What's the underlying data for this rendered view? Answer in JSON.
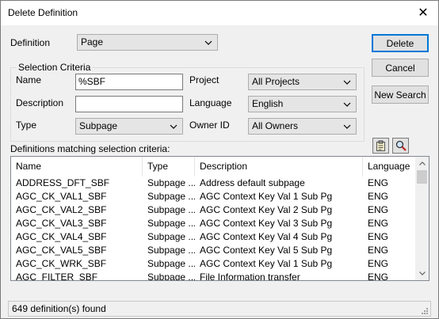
{
  "window": {
    "title": "Delete Definition",
    "close_glyph": "✕"
  },
  "definition": {
    "label": "Definition",
    "value": "Page"
  },
  "buttons": {
    "delete": "Delete",
    "cancel": "Cancel",
    "new_search": "New Search"
  },
  "criteria": {
    "title": "Selection Criteria",
    "name_label": "Name",
    "name_value": "%SBF",
    "description_label": "Description",
    "description_value": "",
    "type_label": "Type",
    "type_value": "Subpage",
    "project_label": "Project",
    "project_value": "All Projects",
    "language_label": "Language",
    "language_value": "English",
    "owner_label": "Owner ID",
    "owner_value": "All Owners"
  },
  "results": {
    "label": "Definitions matching selection criteria:",
    "icons": [
      "clipboard-icon",
      "magnifier-icon"
    ],
    "columns": [
      "Name",
      "Type",
      "Description",
      "Language"
    ],
    "rows": [
      [
        "ADDRESS_DFT_SBF",
        "Subpage ...",
        "Address default subpage",
        "ENG"
      ],
      [
        "AGC_CK_VAL1_SBF",
        "Subpage ...",
        "AGC Context Key Val 1 Sub Pg",
        "ENG"
      ],
      [
        "AGC_CK_VAL2_SBF",
        "Subpage ...",
        "AGC Context Key Val 2 Sub Pg",
        "ENG"
      ],
      [
        "AGC_CK_VAL3_SBF",
        "Subpage ...",
        "AGC Context Key Val 3 Sub Pg",
        "ENG"
      ],
      [
        "AGC_CK_VAL4_SBF",
        "Subpage ...",
        "AGC Context Key Val 4 Sub Pg",
        "ENG"
      ],
      [
        "AGC_CK_VAL5_SBF",
        "Subpage ...",
        "AGC Context Key Val 5 Sub Pg",
        "ENG"
      ],
      [
        "AGC_CK_WRK_SBF",
        "Subpage ...",
        "AGC Context Key Val 1 Sub Pg",
        "ENG"
      ],
      [
        "AGC_FILTER_SBF",
        "Subpage ...",
        "File Information transfer",
        "ENG"
      ]
    ]
  },
  "status": {
    "text": "649 definition(s) found"
  },
  "colors": {
    "accent": "#0078d7",
    "face": "#f0f0f0"
  }
}
